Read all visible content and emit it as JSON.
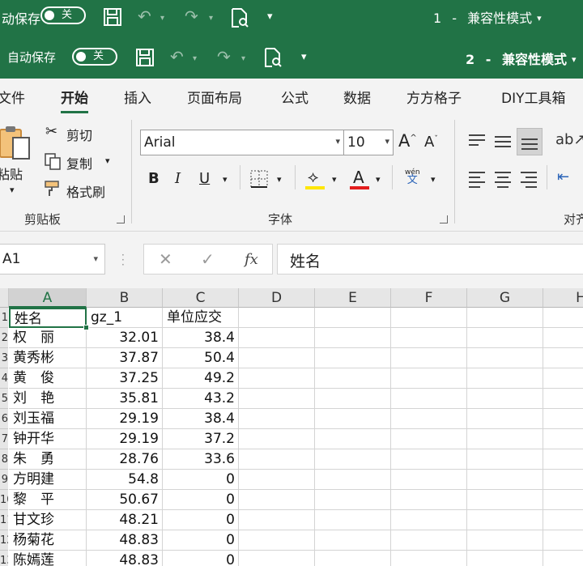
{
  "titlebar_back": {
    "autosave_label": "自动保存",
    "toggle_state": "关",
    "doc_number": "1",
    "separator": "-",
    "mode": "兼容性模式"
  },
  "titlebar_front": {
    "autosave_label": "自动保存",
    "toggle_state": "关",
    "doc_number": "2",
    "separator": "-",
    "mode": "兼容性模式"
  },
  "tabs": [
    "文件",
    "开始",
    "插入",
    "页面布局",
    "公式",
    "数据",
    "方方格子",
    "DIY工具箱"
  ],
  "active_tab": "开始",
  "clipboard": {
    "paste": "粘贴",
    "cut": "剪切",
    "copy": "复制",
    "format_painter": "格式刷",
    "group_label": "剪贴板"
  },
  "font": {
    "family": "Arial",
    "size": "10",
    "bold": "B",
    "italic": "I",
    "underline": "U",
    "font_color_glyph": "A",
    "phonetic_top": "wén",
    "phonetic_bottom": "文",
    "grow": "A",
    "shrink": "A",
    "group_label": "字体",
    "highlight_color": "#ffe600",
    "font_color": "#e31d1d"
  },
  "alignment": {
    "group_label": "对齐"
  },
  "formula_bar": {
    "name_box": "A1",
    "cancel": "✕",
    "enter": "✓",
    "fx": "fx",
    "content": "姓名"
  },
  "sheet": {
    "columns": [
      "A",
      "B",
      "C",
      "D",
      "E",
      "F",
      "G",
      "H"
    ],
    "selected_column": "A",
    "row_numbers": [
      "1",
      "2",
      "3",
      "4",
      "5",
      "6",
      "7",
      "8",
      "9",
      "10",
      "11",
      "12",
      "13"
    ],
    "rows": [
      [
        "姓名",
        "gz_1",
        "单位应交"
      ],
      [
        "权　丽",
        "32.01",
        "38.4"
      ],
      [
        "黄秀彬",
        "37.87",
        "50.4"
      ],
      [
        "黄　俊",
        "37.25",
        "49.2"
      ],
      [
        "刘　艳",
        "35.81",
        "43.2"
      ],
      [
        "刘玉福",
        "29.19",
        "38.4"
      ],
      [
        "钟开华",
        "29.19",
        "37.2"
      ],
      [
        "朱　勇",
        "28.76",
        "33.6"
      ],
      [
        "方明建",
        "54.8",
        "0"
      ],
      [
        "黎　平",
        "50.67",
        "0"
      ],
      [
        "甘文珍",
        "48.21",
        "0"
      ],
      [
        "杨菊花",
        "48.83",
        "0"
      ],
      [
        "陈嫣莲",
        "48.83",
        "0"
      ]
    ]
  },
  "colors": {
    "accent": "#217346",
    "ribbon_bg": "#f3f3f3"
  }
}
